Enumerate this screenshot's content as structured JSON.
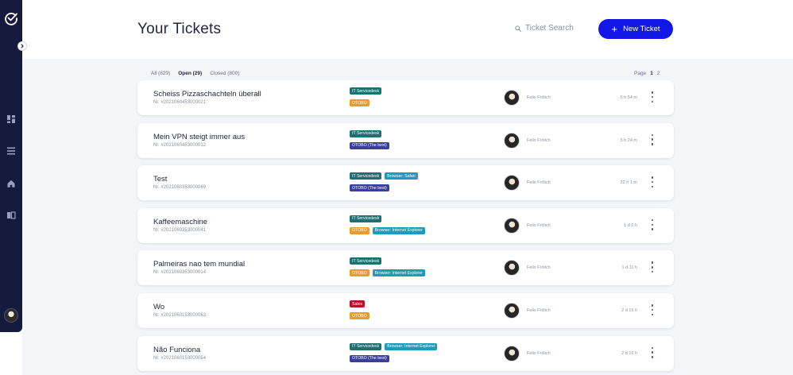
{
  "header": {
    "title": "Your Tickets",
    "search_placeholder": "Ticket Search",
    "new_ticket_label": "New Ticket"
  },
  "filters": [
    {
      "label": "All (829)",
      "active": false
    },
    {
      "label": "Open (29)",
      "active": true
    },
    {
      "label": "Closed (800)",
      "active": false
    }
  ],
  "pagination": {
    "label": "Page",
    "pages": [
      "1",
      "2"
    ],
    "current": "1"
  },
  "tag_colors": {
    "IT Servicedesk": "#1f6e70",
    "OTOBO": "#e89b2e",
    "OTOBO (The best)": "#3b3f9c",
    "Browser: Safari": "#1d9bb8",
    "Browser: Internet Explorer": "#1d9bb8",
    "Sales": "#b3122f"
  },
  "tickets": [
    {
      "title": "Scheiss Pizzaschachteln überall",
      "number": "Nr. #2021060453000021",
      "tags": [
        "IT Servicedesk",
        "OTOBO"
      ],
      "assignee": "Felix Frölich",
      "time": "5 h 54 m"
    },
    {
      "title": "Mein VPN steigt immer aus",
      "number": "Nr. #2021060453000012",
      "tags": [
        "IT Servicedesk",
        "OTOBO (The best)"
      ],
      "assignee": "Felix Frölich",
      "time": "5 h 24 m"
    },
    {
      "title": "Test",
      "number": "Nr. #2021060353000069",
      "tags": [
        "IT Servicedesk",
        "Browser: Safari",
        "OTOBO (The best)"
      ],
      "assignee": "Felix Frölich",
      "time": "22 h 1 m"
    },
    {
      "title": "Kaffeemaschine",
      "number": "Nr. #2021060353000041",
      "tags": [
        "IT Servicedesk",
        "OTOBO",
        "Browser: Internet Explorer"
      ],
      "assignee": "Felix Frölich",
      "time": "1 d 0 h"
    },
    {
      "title": "Palmeiras nao tem mundial",
      "number": "Nr. #2021060353000014",
      "tags": [
        "IT Servicedesk",
        "OTOBO",
        "Browser: Internet Explorer"
      ],
      "assignee": "Felix Frölich",
      "time": "1 d 11 h"
    },
    {
      "title": "Wo",
      "number": "Nr. #2021060153000063",
      "tags": [
        "Sales",
        "OTOBO"
      ],
      "assignee": "Felix Frölich",
      "time": "2 d 15 h"
    },
    {
      "title": "Não Funciona",
      "number": "Nr. #2021060153000054",
      "tags": [
        "IT Servicedesk",
        "Browser: Internet Explorer",
        "OTOBO (The best)"
      ],
      "assignee": "Felix Frölich",
      "time": "2 d 16 h"
    }
  ],
  "icons": {
    "logo": "check-circle-icon",
    "collapse": "chevron-right-icon",
    "nav": [
      "dashboard-icon",
      "list-icon",
      "home-icon",
      "book-icon"
    ],
    "search": "search-icon",
    "new_ticket": "plus-icon",
    "row_menu": "more-vertical-icon"
  },
  "colors": {
    "sidebar": "#161a3c",
    "accent": "#1217e6",
    "background": "#f4f5f9"
  }
}
